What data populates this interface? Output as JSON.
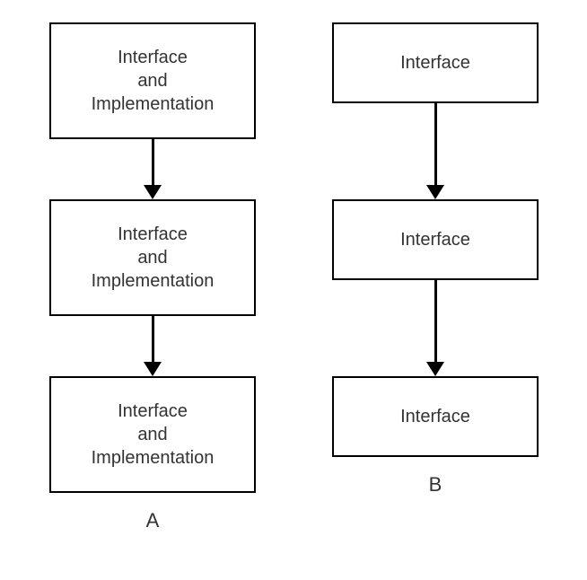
{
  "diagram": {
    "columns": [
      {
        "label": "A",
        "boxes": [
          {
            "line1": "Interface",
            "line2": "and",
            "line3": "Implementation"
          },
          {
            "line1": "Interface",
            "line2": "and",
            "line3": "Implementation"
          },
          {
            "line1": "Interface",
            "line2": "and",
            "line3": "Implementation"
          }
        ]
      },
      {
        "label": "B",
        "boxes": [
          {
            "line1": "Interface"
          },
          {
            "line1": "Interface"
          },
          {
            "line1": "Interface"
          }
        ]
      }
    ]
  }
}
